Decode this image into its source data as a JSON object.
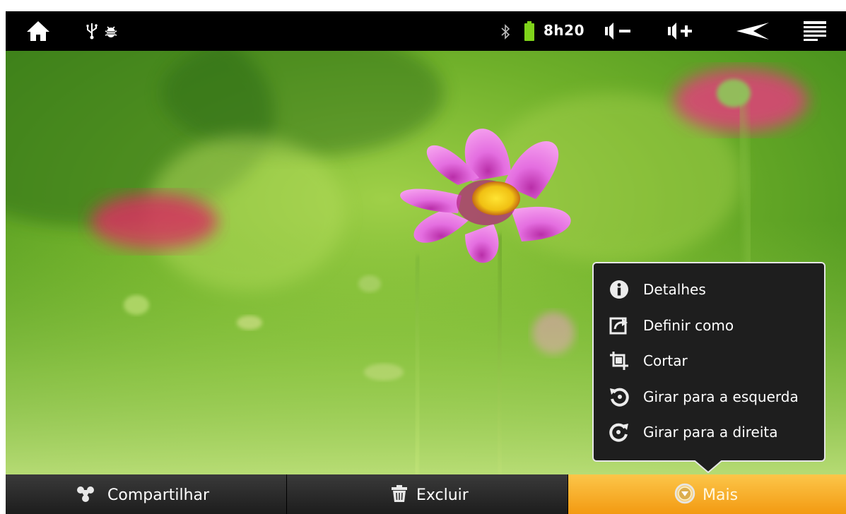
{
  "status_bar": {
    "time": "8h20",
    "icons": [
      "home-icon",
      "usb-icon",
      "android-debug-icon",
      "bluetooth-icon",
      "battery-icon",
      "volume-down-icon",
      "volume-up-icon",
      "back-icon",
      "menu-icon"
    ],
    "battery_color": "#7fd31a"
  },
  "popup_menu": {
    "items": [
      {
        "label": "Detalhes",
        "icon": "info-icon"
      },
      {
        "label": "Definir como",
        "icon": "set-as-icon"
      },
      {
        "label": "Cortar",
        "icon": "crop-icon"
      },
      {
        "label": "Girar para a esquerda",
        "icon": "rotate-left-icon"
      },
      {
        "label": "Girar para a direita",
        "icon": "rotate-right-icon"
      }
    ]
  },
  "action_bar": {
    "share_label": "Compartilhar",
    "delete_label": "Excluir",
    "more_label": "Mais",
    "more_color": "#f6a823"
  }
}
